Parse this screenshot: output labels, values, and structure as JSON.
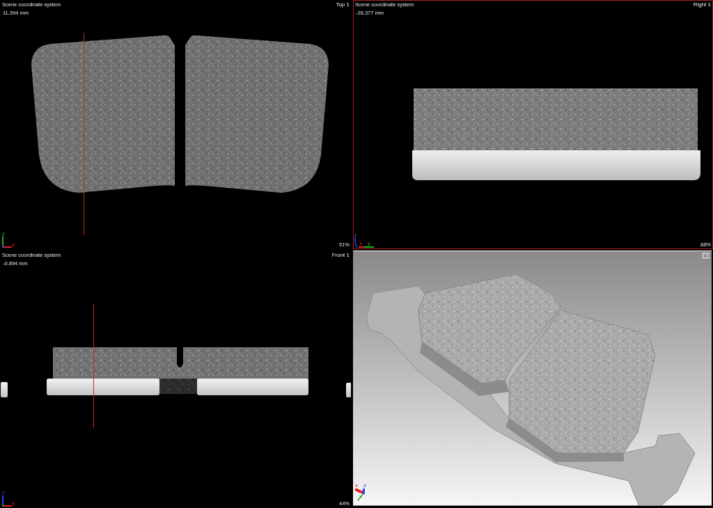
{
  "viewports": [
    {
      "kind": "top",
      "name": "Top 1",
      "coordinate_system": "Scene coordinate system",
      "position": "11.394 mm",
      "zoom": "51%",
      "selected": false,
      "axes": [
        {
          "label": "y",
          "color": "#22b022"
        },
        {
          "label": "x",
          "color": "#e02222"
        }
      ]
    },
    {
      "kind": "right",
      "name": "Right 1",
      "coordinate_system": "Scene coordinate system",
      "position": "-26.377 mm",
      "zoom": "88%",
      "selected": true,
      "axes": [
        {
          "label": "x",
          "color": "#e02222"
        },
        {
          "label": "y",
          "color": "#22b022"
        }
      ]
    },
    {
      "kind": "front",
      "name": "Front 1",
      "coordinate_system": "Scene coordinate system",
      "position": "-0.894 mm",
      "zoom": "44%",
      "selected": false,
      "axes": [
        {
          "label": "z",
          "color": "#3344ff"
        },
        {
          "label": "x",
          "color": "#e02222"
        }
      ]
    },
    {
      "kind": "perspective",
      "badge": "3D",
      "selected": false,
      "axes": [
        {
          "label": "x",
          "color": "#e02222"
        },
        {
          "label": "z",
          "color": "#3344ff"
        }
      ]
    }
  ]
}
